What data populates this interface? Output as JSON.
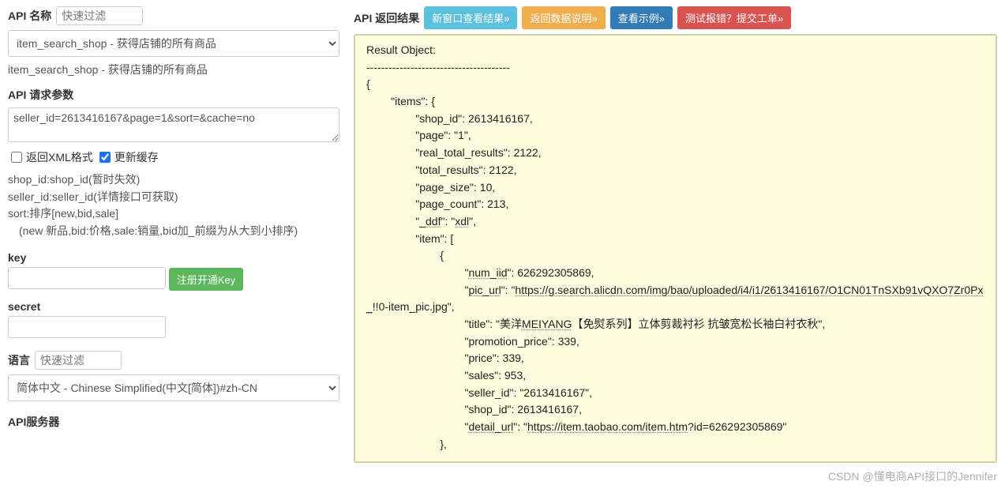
{
  "left": {
    "api_name_label": "API 名称",
    "filter_placeholder": "快速过滤",
    "api_select_value": "item_search_shop - 获得店铺的所有商品",
    "api_selected_text": "item_search_shop - 获得店铺的所有商品",
    "request_params_label": "API 请求参数",
    "request_params_value": "seller_id=2613416167&page=1&sort=&cache=no",
    "chk_xml_label": "返回XML格式",
    "chk_cache_label": "更新缓存",
    "desc_line1": "shop_id:shop_id(暂时失效)",
    "desc_line2": "seller_id:seller_id(详情接口可获取)",
    "desc_line3": "sort:排序[new,bid,sale]",
    "desc_line4": "　(new 新品,bid:价格,sale:销量,bid加_前缀为从大到小排序)",
    "key_label": "key",
    "key_value": "",
    "reg_key_btn": "注册开通Key",
    "secret_label": "secret",
    "secret_value": "",
    "lang_label": "语言",
    "lang_filter_placeholder": "快速过滤",
    "lang_select_value": "简体中文 - Chinese Simplified(中文[简体])#zh-CN",
    "server_label": "API服务器"
  },
  "right": {
    "result_label": "API 返回结果",
    "btn_new_window": "新窗口查看结果»",
    "btn_return_desc": "返回数据说明»",
    "btn_view_example": "查看示例»",
    "btn_submit_ticket": "测试报错？提交工单»"
  },
  "result_text": "Result Object:\n---------------------------------------\n{\n\t\"items\": {\n\t\t\"shop_id\": 2613416167,\n\t\t\"page\": \"1\",\n\t\t\"real_total_results\": 2122,\n\t\t\"total_results\": 2122,\n\t\t\"page_size\": 10,\n\t\t\"page_count\": 213,\n\t\t\"_ddf\": \"xdl\",\n\t\t\"item\": [\n\t\t\t{\n\t\t\t\t\"num_iid\": 626292305869,\n\t\t\t\t\"pic_url\": \"https://g.search.alicdn.com/img/bao/uploaded/i4/i1/2613416167/O1CN01TnSXb91vQXO7Zr0Px_!!0-item_pic.jpg\",\n\t\t\t\t\"title\": \"美洋MEIYANG【免熨系列】立体剪裁衬衫 抗皱宽松长袖白衬衣秋\",\n\t\t\t\t\"promotion_price\": 339,\n\t\t\t\t\"price\": 339,\n\t\t\t\t\"sales\": 953,\n\t\t\t\t\"seller_id\": \"2613416167\",\n\t\t\t\t\"shop_id\": 2613416167,\n\t\t\t\t\"detail_url\": \"https://item.taobao.com/item.htm?id=626292305869\"\n\t\t\t},",
  "watermark": "CSDN @懂电商API接口的Jennifer"
}
